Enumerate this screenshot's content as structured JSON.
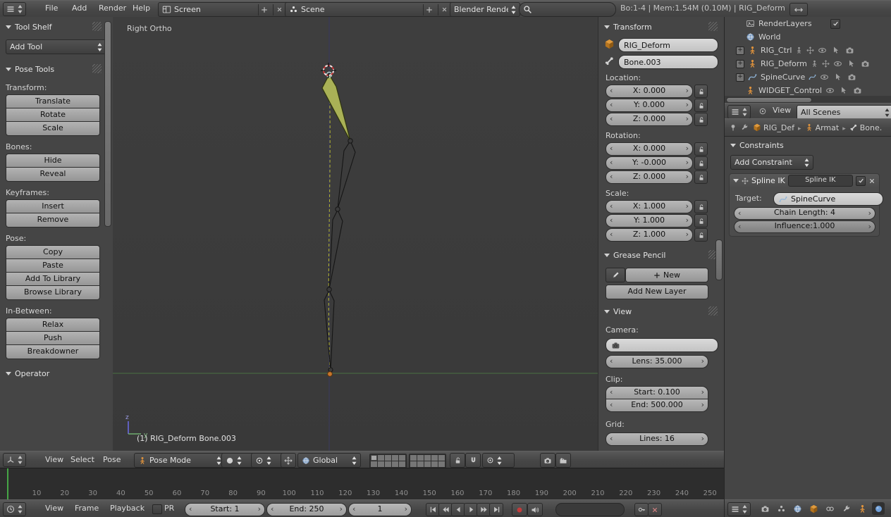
{
  "topbar": {
    "menus": {
      "file": "File",
      "add": "Add",
      "render": "Render",
      "help": "Help"
    },
    "screen_name": "Screen",
    "scene_name": "Scene",
    "engine": "Blender Render",
    "stats": "Bo:1-4 | Mem:1.54M (0.10M) | RIG_Deform"
  },
  "toolshelf": {
    "title": "Tool Shelf",
    "add_tool_label": "Add Tool",
    "pose_tools_title": "Pose Tools",
    "transform_label": "Transform:",
    "translate": "Translate",
    "rotate": "Rotate",
    "scale": "Scale",
    "bones_label": "Bones:",
    "hide": "Hide",
    "reveal": "Reveal",
    "keyframes_label": "Keyframes:",
    "insert": "Insert",
    "remove": "Remove",
    "pose_label": "Pose:",
    "copy": "Copy",
    "paste": "Paste",
    "add_to_library": "Add To Library",
    "browse_library": "Browse Library",
    "inbetween_label": "In-Between:",
    "relax": "Relax",
    "push": "Push",
    "breakdowner": "Breakdowner",
    "operator_title": "Operator"
  },
  "viewport": {
    "view_label": "Right Ortho",
    "status_text": "(1) RIG_Deform Bone.003",
    "axis_z": "z",
    "axis_y": "y"
  },
  "npanel": {
    "transform_title": "Transform",
    "object_name": "RIG_Deform",
    "bone_name": "Bone.003",
    "location_label": "Location:",
    "loc_x": "X: 0.000",
    "loc_y": "Y: 0.000",
    "loc_z": "Z: 0.000",
    "rotation_label": "Rotation:",
    "rot_x": "X: 0.000",
    "rot_y": "Y: -0.000",
    "rot_z": "Z: 0.000",
    "scale_label": "Scale:",
    "scl_x": "X: 1.000",
    "scl_y": "Y: 1.000",
    "scl_z": "Z: 1.000",
    "grease_title": "Grease Pencil",
    "new_label": "New",
    "add_new_layer_label": "Add New Layer",
    "view_title": "View",
    "camera_label": "Camera:",
    "lens": "Lens: 35.000",
    "clip_label": "Clip:",
    "clip_start": "Start: 0.100",
    "clip_end": "End: 500.000",
    "grid_label": "Grid:",
    "grid_lines": "Lines: 16"
  },
  "outliner": {
    "renderlayers": "RenderLayers",
    "items": [
      {
        "label": "World"
      },
      {
        "label": "RIG_Ctrl"
      },
      {
        "label": "RIG_Deform"
      },
      {
        "label": "SpineCurve"
      },
      {
        "label": "WIDGET_Control"
      }
    ],
    "view_menu": "View",
    "display_mode": "All Scenes"
  },
  "properties": {
    "breadcrumb": {
      "object": "RIG_Def",
      "data": "Armat",
      "bone": "Bone."
    },
    "constraints_title": "Constraints",
    "add_constraint_label": "Add Constraint",
    "constraint": {
      "type_label": "Spline IK",
      "name_value": "Spline IK",
      "target_label": "Target:",
      "target_value": "SpineCurve",
      "chain_length": "Chain Length: 4",
      "influence": "Influence:1.000"
    }
  },
  "view3d_header": {
    "menus": {
      "view": "View",
      "select": "Select",
      "pose": "Pose"
    },
    "mode": "Pose Mode",
    "orientation": "Global"
  },
  "timeline": {
    "menus": {
      "view": "View",
      "frame": "Frame",
      "playback": "Playback"
    },
    "pr_label": "PR",
    "start": "Start: 1",
    "end": "End: 250",
    "current_frame": "1",
    "ticks": [
      10,
      20,
      30,
      40,
      50,
      60,
      70,
      80,
      90,
      100,
      110,
      120,
      130,
      140,
      150,
      160,
      170,
      180,
      190,
      200,
      210,
      220,
      230,
      240,
      250
    ]
  }
}
